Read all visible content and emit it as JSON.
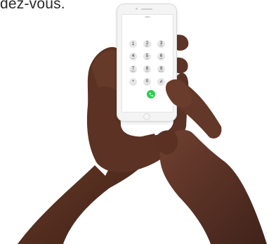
{
  "header": {
    "text": "dez-vous."
  },
  "phone": {
    "status_time": "9:41",
    "keys": [
      {
        "digit": "1",
        "letters": ""
      },
      {
        "digit": "2",
        "letters": "ABC"
      },
      {
        "digit": "3",
        "letters": "DEF"
      },
      {
        "digit": "4",
        "letters": "GHI"
      },
      {
        "digit": "5",
        "letters": "JKL"
      },
      {
        "digit": "6",
        "letters": "MNO"
      },
      {
        "digit": "7",
        "letters": "PQRS"
      },
      {
        "digit": "8",
        "letters": "TUV"
      },
      {
        "digit": "9",
        "letters": "WXYZ"
      },
      {
        "digit": "*",
        "letters": ""
      },
      {
        "digit": "0",
        "letters": "+"
      },
      {
        "digit": "#",
        "letters": ""
      }
    ],
    "call_icon": "phone-handset-icon"
  },
  "colors": {
    "call_button": "#2ecc52",
    "skin": "#5a3222",
    "skin_dark": "#3f2118",
    "key_bg": "#e6e6e6"
  }
}
